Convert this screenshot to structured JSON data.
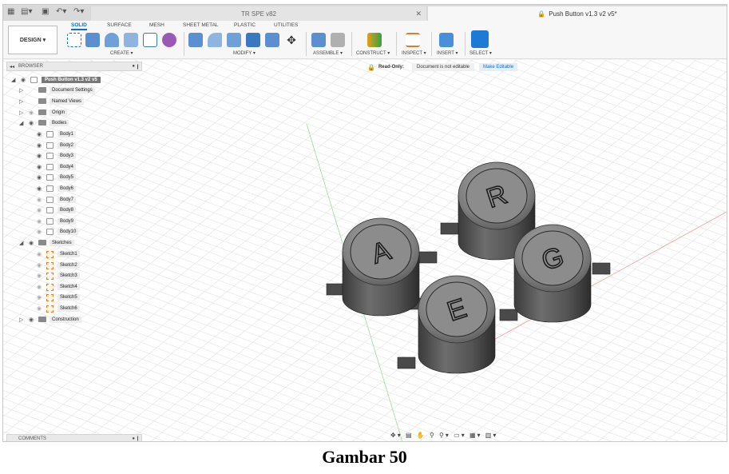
{
  "window": {
    "inactive_tab": "TR SPE v82",
    "active_tab": "Push Button v1.3 v2 v5*"
  },
  "ribbon": {
    "workspace_button": "DESIGN ▾",
    "tabs": [
      "SOLID",
      "SURFACE",
      "MESH",
      "SHEET METAL",
      "PLASTIC",
      "UTILITIES"
    ],
    "active_tab": "SOLID",
    "groups": [
      "CREATE ▾",
      "MODIFY ▾",
      "ASSEMBLE ▾",
      "CONSTRUCT ▾",
      "INSPECT ▾",
      "INSERT ▾",
      "SELECT ▾"
    ]
  },
  "browser": {
    "title": "BROWSER",
    "root": "Push Button v1.3 v2 v5",
    "top_items": [
      "Document Settings",
      "Named Views",
      "Origin",
      "Bodies"
    ],
    "bodies": [
      "Body1",
      "Body2",
      "Body3",
      "Body4",
      "Body5",
      "Body6",
      "Body7",
      "Body8",
      "Body9",
      "Body10"
    ],
    "sketches_folder": "Sketches",
    "sketches": [
      "Sketch1",
      "Sketch2",
      "Sketch3",
      "Sketch4",
      "Sketch5",
      "Sketch6"
    ],
    "construction": "Construction"
  },
  "readonly_bar": {
    "label": "Read-Only:",
    "message": "Document is not editable",
    "action": "Make Editable"
  },
  "comments": {
    "title": "COMMENTS"
  },
  "model": {
    "buttons": [
      {
        "letter": "A"
      },
      {
        "letter": "R"
      },
      {
        "letter": "G"
      },
      {
        "letter": "E"
      }
    ]
  },
  "caption": "Gambar 50"
}
